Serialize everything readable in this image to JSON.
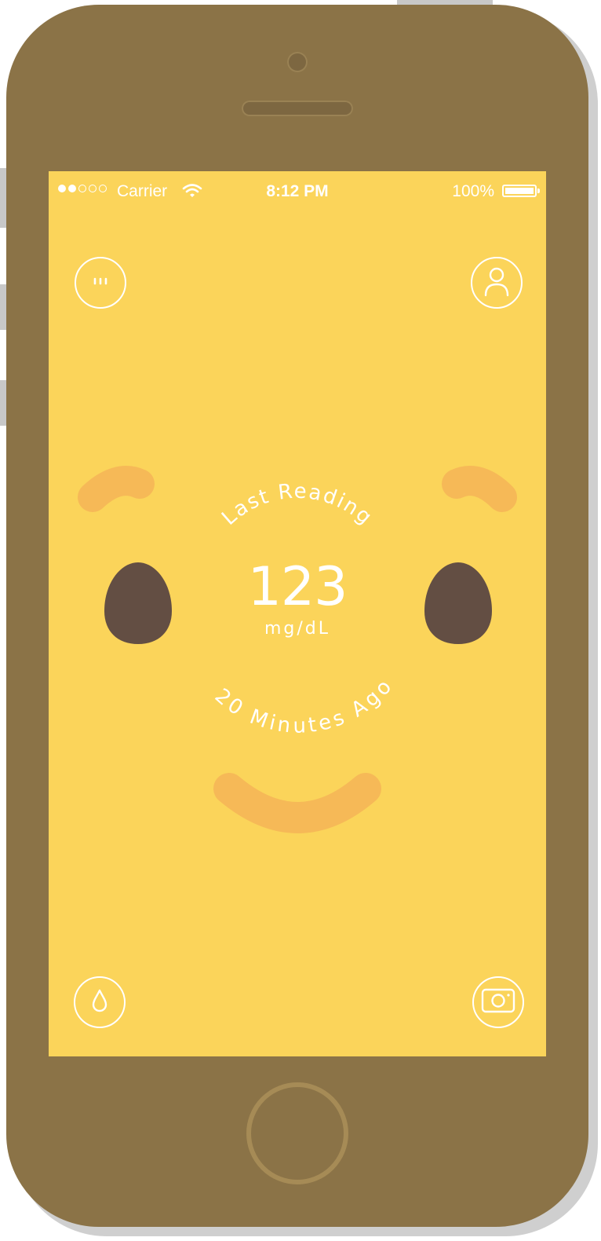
{
  "colors": {
    "screen_background": "#fbd45a",
    "phone_body": "#8b7347",
    "face_features": "#f6b957",
    "eyes": "#634e43",
    "icon_stroke": "#ffffff"
  },
  "status_bar": {
    "signal_full_dots": 2,
    "signal_total_dots": 5,
    "carrier": "Carrier",
    "time": "8:12 PM",
    "battery_percent": "100%",
    "battery_level": 1.0
  },
  "buttons": {
    "menu_icon": "more-dots-icon",
    "profile_icon": "user-profile-icon",
    "drop_icon": "blood-drop-icon",
    "camera_icon": "camera-icon"
  },
  "reading": {
    "top_label": "Last Reading",
    "value": "123",
    "unit": "mg/dL",
    "bottom_label": "20 Minutes Ago"
  }
}
